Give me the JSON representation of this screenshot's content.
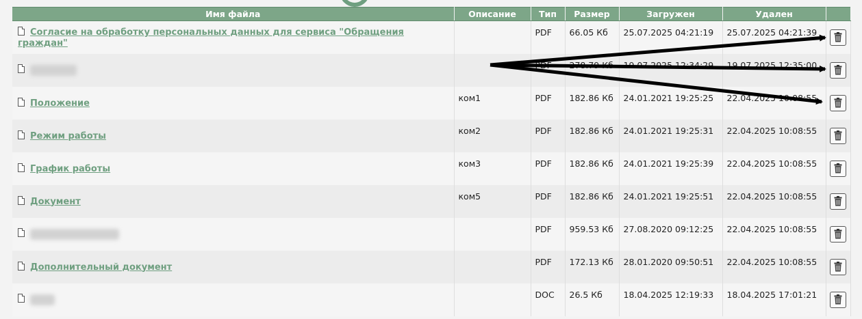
{
  "table": {
    "headers": {
      "name": "Имя файла",
      "description": "Описание",
      "type": "Тип",
      "size": "Размер",
      "uploaded": "Загружен",
      "deleted": "Удален"
    },
    "rows": [
      {
        "name": "Согласие на обработку персональных данных для сервиса \"Обращения граждан\"",
        "description": "",
        "type": "PDF",
        "size": "66.05 Кб",
        "uploaded": "25.07.2025 04:21:19",
        "deleted": "25.07.2025 04:21:39",
        "blurred": false
      },
      {
        "name": "",
        "description": "",
        "type": "PDF",
        "size": "278.79 Кб",
        "uploaded": "19.07.2025 12:34:29",
        "deleted": "19.07.2025 12:35:00",
        "blurred": true
      },
      {
        "name": "Положение",
        "description": "ком1",
        "type": "PDF",
        "size": "182.86 Кб",
        "uploaded": "24.01.2021 19:25:25",
        "deleted": "22.04.2025 10:08:55",
        "blurred": false
      },
      {
        "name": "Режим работы",
        "description": "ком2",
        "type": "PDF",
        "size": "182.86 Кб",
        "uploaded": "24.01.2021 19:25:31",
        "deleted": "22.04.2025 10:08:55",
        "blurred": false
      },
      {
        "name": "График работы",
        "description": "ком3",
        "type": "PDF",
        "size": "182.86 Кб",
        "uploaded": "24.01.2021 19:25:39",
        "deleted": "22.04.2025 10:08:55",
        "blurred": false
      },
      {
        "name": "Документ",
        "description": "ком5",
        "type": "PDF",
        "size": "182.86 Кб",
        "uploaded": "24.01.2021 19:25:51",
        "deleted": "22.04.2025 10:08:55",
        "blurred": false
      },
      {
        "name": "",
        "description": "",
        "type": "PDF",
        "size": "959.53 Кб",
        "uploaded": "27.08.2020 09:12:25",
        "deleted": "22.04.2025 10:08:55",
        "blurred": true
      },
      {
        "name": "Дополнительный документ",
        "description": "",
        "type": "PDF",
        "size": "172.13 Кб",
        "uploaded": "28.01.2020 09:50:51",
        "deleted": "22.04.2025 10:08:55",
        "blurred": false
      },
      {
        "name": "",
        "description": "",
        "type": "DOC",
        "size": "26.5 Кб",
        "uploaded": "18.04.2025 12:19:33",
        "deleted": "18.04.2025 17:01:21",
        "blurred": true
      }
    ]
  },
  "icons": {
    "file": "file-icon",
    "delete": "trash-icon"
  },
  "colors": {
    "header_bg": "#7da688",
    "link": "#6f9f80",
    "arrow": "#000000"
  }
}
